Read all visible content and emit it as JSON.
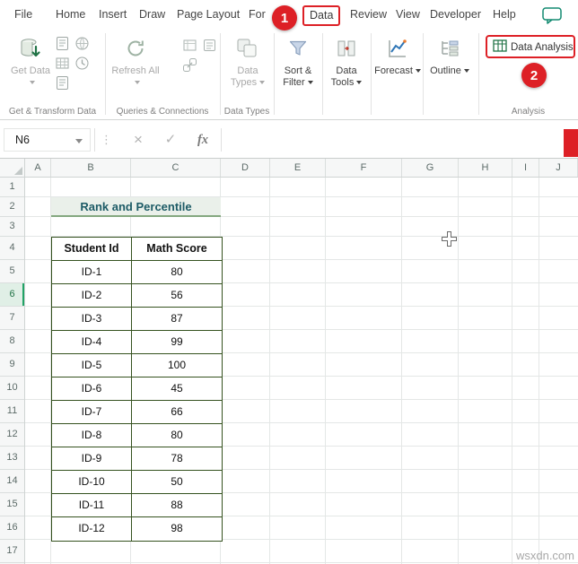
{
  "menubar": {
    "tabs": [
      {
        "label": "File"
      },
      {
        "label": "Home"
      },
      {
        "label": "Insert"
      },
      {
        "label": "Draw"
      },
      {
        "label": "Page Layout"
      },
      {
        "label": "For"
      },
      {
        "label": "Data",
        "highlighted": true
      },
      {
        "label": "Review"
      },
      {
        "label": "View"
      },
      {
        "label": "Developer"
      },
      {
        "label": "Help"
      }
    ]
  },
  "annotations": {
    "step1_label": "1",
    "step2_label": "2",
    "accent_color": "#dd2026"
  },
  "ribbon": {
    "buttons": {
      "get_data": "Get Data",
      "refresh_all": "Refresh All",
      "data_types": "Data Types",
      "sort_filter": "Sort & Filter",
      "data_tools": "Data Tools",
      "forecast": "Forecast",
      "outline": "Outline",
      "data_analysis": "Data Analysis"
    },
    "group_labels": {
      "get_transform": "Get & Transform Data",
      "queries": "Queries & Connections",
      "data_types": "Data Types",
      "analysis": "Analysis"
    }
  },
  "formula_bar": {
    "name_box": "N6",
    "dots_icon": "⋮",
    "cancel_icon": "×",
    "enter_icon": "✓",
    "fx_icon": "fx"
  },
  "grid": {
    "columns": [
      "A",
      "B",
      "C",
      "D",
      "E",
      "F",
      "G",
      "H",
      "I",
      "J"
    ],
    "rows": [
      "1",
      "2",
      "3",
      "4",
      "5",
      "6",
      "7",
      "8",
      "9",
      "10",
      "11",
      "12",
      "13",
      "14",
      "15",
      "16",
      "17"
    ],
    "selected_row": "6"
  },
  "sheet": {
    "title": "Rank and Percentile",
    "table": {
      "headers": [
        "Student Id",
        "Math Score"
      ],
      "rows": [
        [
          "ID-1",
          "80"
        ],
        [
          "ID-2",
          "56"
        ],
        [
          "ID-3",
          "87"
        ],
        [
          "ID-4",
          "99"
        ],
        [
          "ID-5",
          "100"
        ],
        [
          "ID-6",
          "45"
        ],
        [
          "ID-7",
          "66"
        ],
        [
          "ID-8",
          "80"
        ],
        [
          "ID-9",
          "78"
        ],
        [
          "ID-10",
          "50"
        ],
        [
          "ID-11",
          "88"
        ],
        [
          "ID-12",
          "98"
        ]
      ]
    }
  },
  "watermark": "wsxdn.com",
  "colors": {
    "excel_green": "#217346",
    "table_border": "#35521f",
    "title_fill": "#eaf0ea",
    "title_text": "#1d5b66"
  }
}
